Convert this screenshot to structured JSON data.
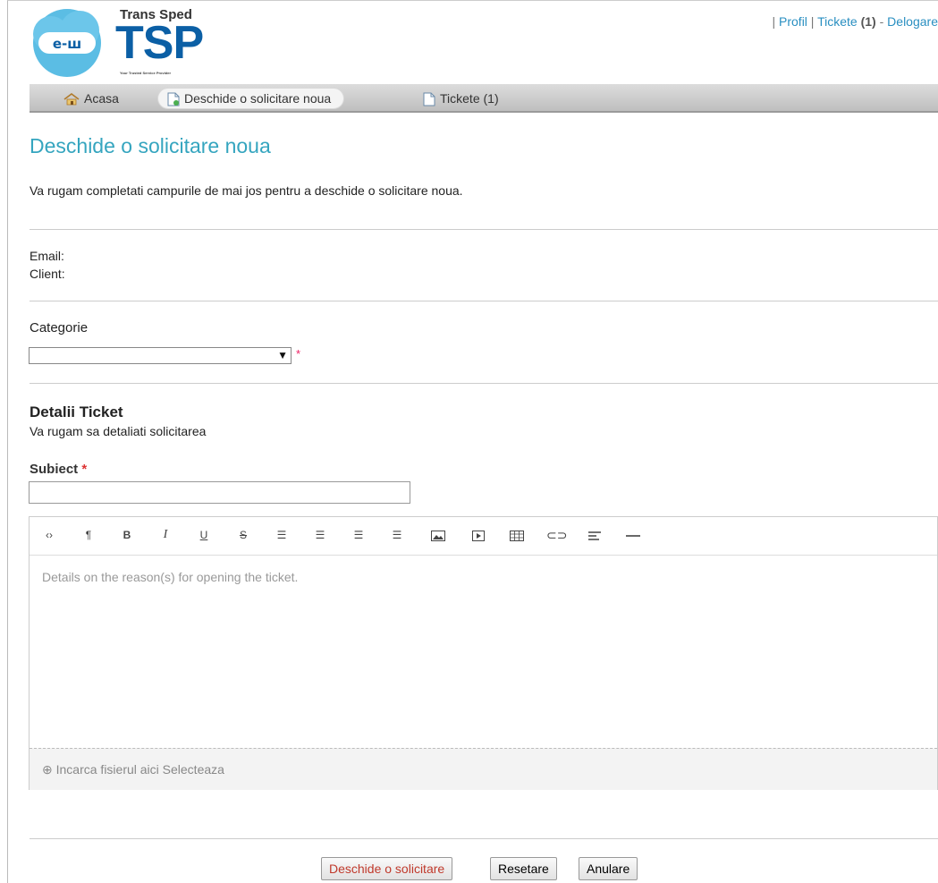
{
  "brand": {
    "title": "Trans Sped",
    "logo_text": "TSP",
    "tagline": "Your Trusted Service Provider",
    "cloud_glyph": "e-ш"
  },
  "toplinks": {
    "profile": "Profil",
    "tickets": "Tickete",
    "tickets_count": "(1)",
    "logout": "Delogare"
  },
  "nav": {
    "home": "Acasa",
    "new_request": "Deschide o solicitare noua",
    "tickets": "Tickete (1)"
  },
  "page": {
    "title": "Deschide o solicitare noua",
    "intro": "Va rugam completati campurile de mai jos pentru a deschide o solicitare noua."
  },
  "user": {
    "email_label": "Email:",
    "client_label": "Client:"
  },
  "category": {
    "label": "Categorie",
    "selected": "",
    "required_marker": "*"
  },
  "details": {
    "heading": "Detalii Ticket",
    "subheading": "Va rugam sa detaliati solicitarea",
    "subject_label": "Subiect",
    "subject_required": "*",
    "subject_value": "",
    "editor_placeholder": "Details on the reason(s) for opening the ticket.",
    "upload_text": "Incarca fisierul aici Selecteaza"
  },
  "toolbar_icons": [
    "code-view",
    "paragraph",
    "bold",
    "italic",
    "underline",
    "strikethrough",
    "unordered-list",
    "ordered-list",
    "outdent",
    "indent",
    "image",
    "video",
    "table",
    "link",
    "align",
    "horizontal-rule"
  ],
  "buttons": {
    "submit": "Deschide o solicitare",
    "reset": "Resetare",
    "cancel": "Anulare"
  },
  "colors": {
    "heading": "#35a5bf",
    "links": "#2a8fc1",
    "brand_blue": "#0b5fa5",
    "cloud": "#5bbde4",
    "required": "#dd3355"
  }
}
